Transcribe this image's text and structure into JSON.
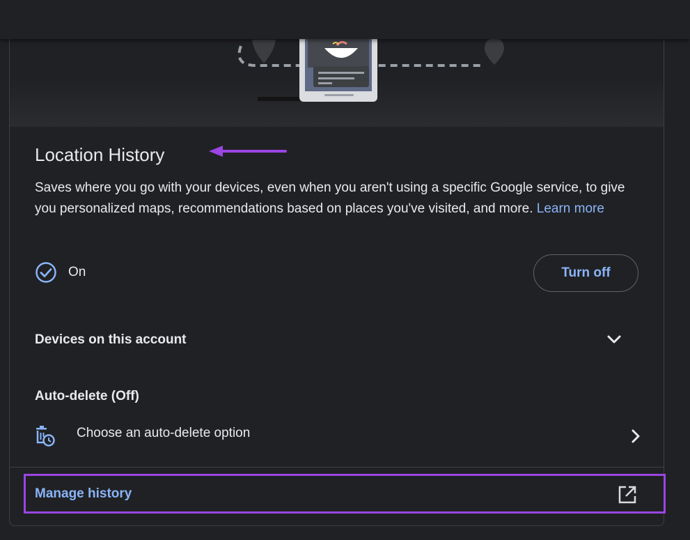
{
  "section": {
    "title": "Location History",
    "description": "Saves where you go with your devices, even when you aren't using a specific Google service, to give you personalized maps, recommendations based on places you've visited, and more.",
    "learn_more": "Learn more"
  },
  "status": {
    "label": "On",
    "icon": "check-circle-icon",
    "turn_off_label": "Turn off"
  },
  "devices": {
    "label": "Devices on this account",
    "icon": "chevron-down-icon"
  },
  "auto_delete": {
    "label": "Auto-delete (Off)",
    "option_label": "Choose an auto-delete option",
    "option_icon": "auto-delete-icon"
  },
  "manage": {
    "label": "Manage history",
    "icon": "open-in-new-icon"
  },
  "colors": {
    "background": "#202124",
    "text": "#e8eaed",
    "link": "#8ab4f8",
    "annotation": "#9b45e4"
  }
}
